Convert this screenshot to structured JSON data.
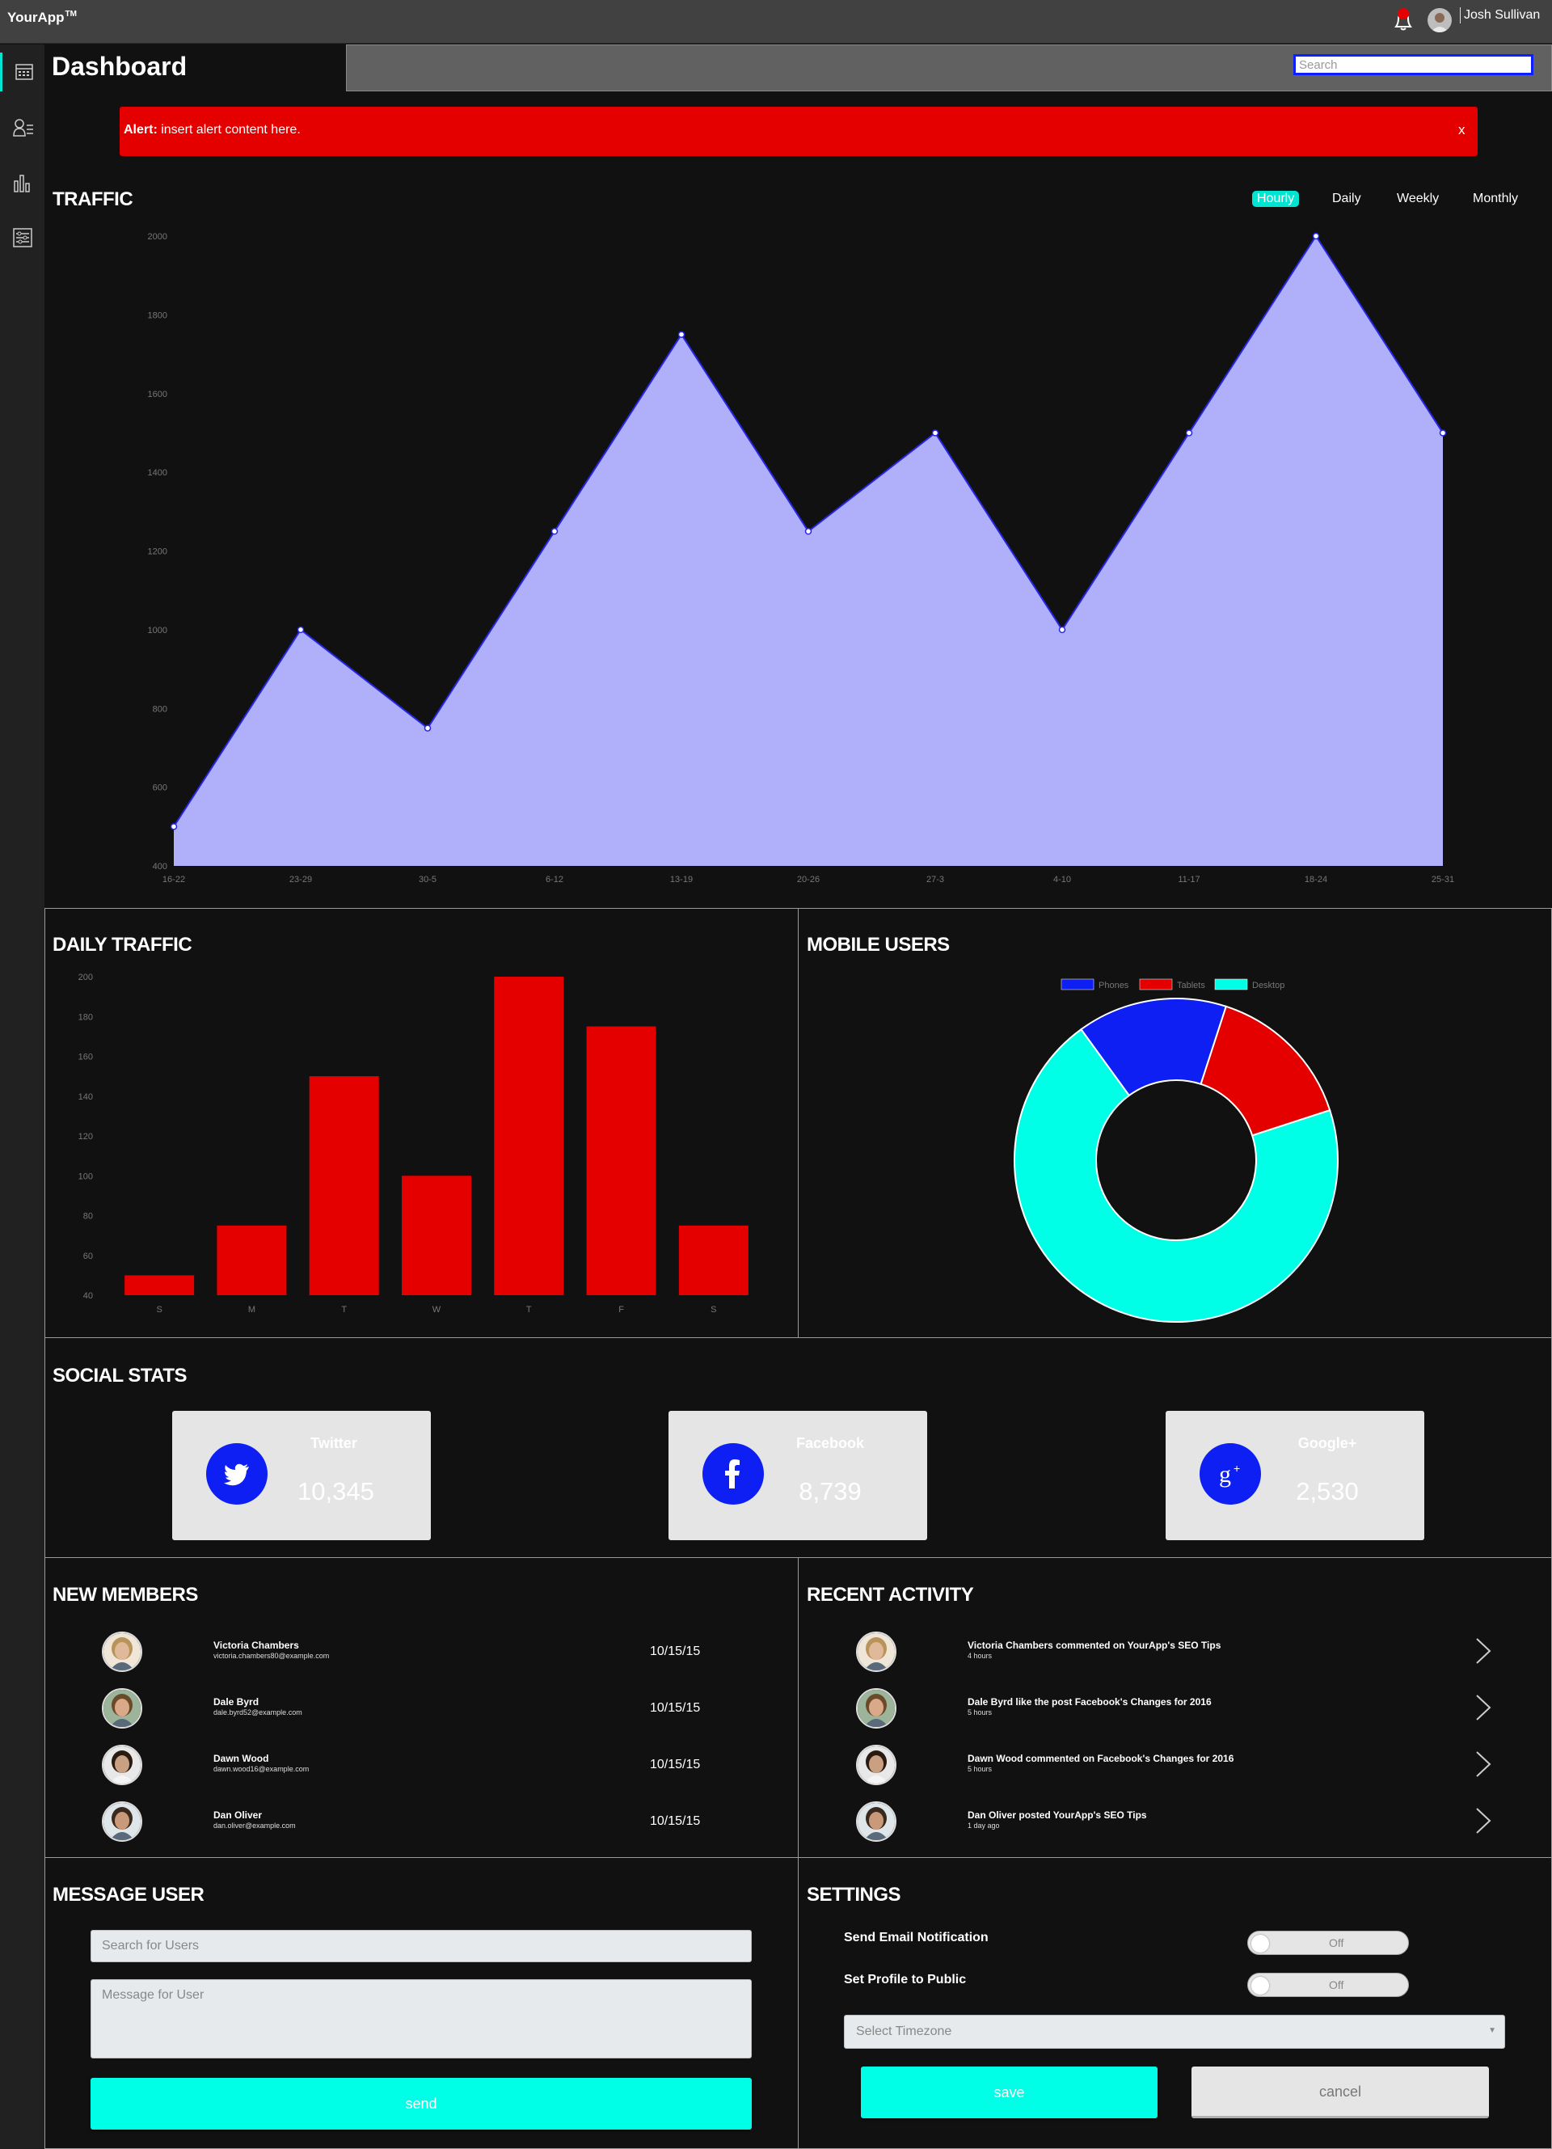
{
  "app": {
    "name": "YourApp",
    "trademark": "TM",
    "user": "Josh Sullivan"
  },
  "page": {
    "title": "Dashboard"
  },
  "search": {
    "placeholder": "Search"
  },
  "alert": {
    "label": "Alert:",
    "text": " insert alert content here.",
    "close": "x"
  },
  "traffic": {
    "title": "TRAFFIC",
    "tabs": [
      "Hourly",
      "Daily",
      "Weekly",
      "Monthly"
    ],
    "active_tab": "Hourly"
  },
  "daily_traffic": {
    "title": "DAILY TRAFFIC"
  },
  "mobile_users": {
    "title": "MOBILE USERS"
  },
  "chart_data": [
    {
      "type": "area",
      "name": "traffic",
      "x": [
        "16-22",
        "23-29",
        "30-5",
        "6-12",
        "13-19",
        "20-26",
        "27-3",
        "4-10",
        "11-17",
        "18-24",
        "25-31"
      ],
      "values": [
        500,
        1000,
        750,
        1250,
        1750,
        1250,
        1500,
        1000,
        1500,
        2000,
        1500
      ],
      "yticks": [
        400,
        600,
        800,
        1000,
        1200,
        1400,
        1600,
        1800,
        2000
      ],
      "ylim": [
        400,
        2000
      ],
      "fill": "#b0b0fa",
      "line": "#2626e6"
    },
    {
      "type": "bar",
      "name": "daily-traffic",
      "categories": [
        "S",
        "M",
        "T",
        "W",
        "T",
        "F",
        "S"
      ],
      "values": [
        50,
        75,
        150,
        100,
        200,
        175,
        75
      ],
      "yticks": [
        40,
        60,
        80,
        100,
        120,
        140,
        160,
        180,
        200
      ],
      "ylim": [
        40,
        200
      ],
      "color": "#e50000"
    },
    {
      "type": "pie",
      "name": "mobile-users",
      "donut": true,
      "legend": "top",
      "categories": [
        "Phones",
        "Tablets",
        "Desktop"
      ],
      "values": [
        15,
        15,
        70
      ],
      "colors": [
        "#0d1ff2",
        "#e50000",
        "#00ffe7"
      ]
    }
  ],
  "social": {
    "title": "SOCIAL STATS",
    "cards": [
      {
        "name": "Twitter",
        "count": "10,345",
        "icon": "twitter-icon"
      },
      {
        "name": "Facebook",
        "count": "8,739",
        "icon": "facebook-icon"
      },
      {
        "name": "Google+",
        "count": "2,530",
        "icon": "google-plus-icon"
      }
    ]
  },
  "members": {
    "title": "NEW MEMBERS",
    "items": [
      {
        "name": "Victoria Chambers",
        "email": "victoria.chambers80@example.com",
        "date": "10/15/15"
      },
      {
        "name": "Dale Byrd",
        "email": "dale.byrd52@example.com",
        "date": "10/15/15"
      },
      {
        "name": "Dawn Wood",
        "email": "dawn.wood16@example.com",
        "date": "10/15/15"
      },
      {
        "name": "Dan Oliver",
        "email": "dan.oliver@example.com",
        "date": "10/15/15"
      }
    ]
  },
  "activity": {
    "title": "RECENT ACTIVITY",
    "items": [
      {
        "text": "Victoria Chambers commented on YourApp's SEO Tips",
        "time": "4 hours"
      },
      {
        "text": "Dale Byrd like the post Facebook's Changes for 2016",
        "time": "5 hours"
      },
      {
        "text": "Dawn Wood commented on Facebook's Changes for 2016",
        "time": "5 hours"
      },
      {
        "text": "Dan Oliver posted YourApp's SEO Tips",
        "time": "1 day ago"
      }
    ]
  },
  "message": {
    "title": "MESSAGE USER",
    "search_placeholder": "Search for Users",
    "message_placeholder": "Message for User",
    "send": "send"
  },
  "settings": {
    "title": "SETTINGS",
    "email_label": "Send Email Notification",
    "email_state": "Off",
    "public_label": "Set Profile to Public",
    "public_state": "Off",
    "timezone_placeholder": "Select Timezone",
    "save": "save",
    "cancel": "cancel"
  },
  "colors": {
    "accent": "#00e5d1",
    "alert": "#e50000",
    "brand_blue": "#0d1ff2"
  }
}
